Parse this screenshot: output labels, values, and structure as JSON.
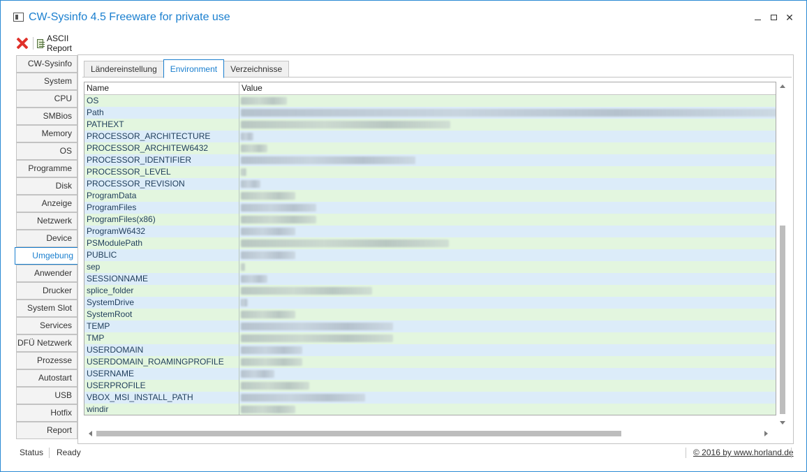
{
  "window": {
    "title": "CW-Sysinfo 4.5 Freeware for private use"
  },
  "toolbar": {
    "close_icon": "red-x-icon",
    "report_icon": "report-icon",
    "report_label": "ASCII Report"
  },
  "sidebar": {
    "active": "Umgebung",
    "items": [
      {
        "label": "CW-Sysinfo"
      },
      {
        "label": "System"
      },
      {
        "label": "CPU"
      },
      {
        "label": "SMBios"
      },
      {
        "label": "Memory"
      },
      {
        "label": "OS"
      },
      {
        "label": "Programme"
      },
      {
        "label": "Disk"
      },
      {
        "label": "Anzeige"
      },
      {
        "label": "Netzwerk"
      },
      {
        "label": "Device"
      },
      {
        "label": "Umgebung"
      },
      {
        "label": "Anwender"
      },
      {
        "label": "Drucker"
      },
      {
        "label": "System Slot"
      },
      {
        "label": "Services"
      },
      {
        "label": "DFÜ Netzwerk"
      },
      {
        "label": "Prozesse"
      },
      {
        "label": "Autostart"
      },
      {
        "label": "USB"
      },
      {
        "label": "Hotfix"
      },
      {
        "label": "Report"
      }
    ]
  },
  "tabs": [
    {
      "label": "Ländereinstellung"
    },
    {
      "label": "Environment"
    },
    {
      "label": "Verzeichnisse"
    }
  ],
  "active_tab": "Environment",
  "table": {
    "columns": [
      "Name",
      "Value"
    ],
    "rows": [
      {
        "name": "OS"
      },
      {
        "name": "Path"
      },
      {
        "name": "PATHEXT"
      },
      {
        "name": "PROCESSOR_ARCHITECTURE"
      },
      {
        "name": "PROCESSOR_ARCHITEW6432"
      },
      {
        "name": "PROCESSOR_IDENTIFIER"
      },
      {
        "name": "PROCESSOR_LEVEL"
      },
      {
        "name": "PROCESSOR_REVISION"
      },
      {
        "name": "ProgramData"
      },
      {
        "name": "ProgramFiles"
      },
      {
        "name": "ProgramFiles(x86)"
      },
      {
        "name": "ProgramW6432"
      },
      {
        "name": "PSModulePath"
      },
      {
        "name": "PUBLIC"
      },
      {
        "name": "sep"
      },
      {
        "name": "SESSIONNAME"
      },
      {
        "name": "splice_folder"
      },
      {
        "name": "SystemDrive"
      },
      {
        "name": "SystemRoot"
      },
      {
        "name": "TEMP"
      },
      {
        "name": "TMP"
      },
      {
        "name": "USERDOMAIN"
      },
      {
        "name": "USERDOMAIN_ROAMINGPROFILE"
      },
      {
        "name": "USERNAME"
      },
      {
        "name": "USERPROFILE"
      },
      {
        "name": "VBOX_MSI_INSTALL_PATH"
      },
      {
        "name": "windir"
      }
    ]
  },
  "statusbar": {
    "label": "Status",
    "value": "Ready",
    "link": "© 2016 by www.horland.de"
  },
  "colors": {
    "accent": "#1a7fcf",
    "row_green": "#e3f6df",
    "row_blue": "#dcecf9"
  }
}
